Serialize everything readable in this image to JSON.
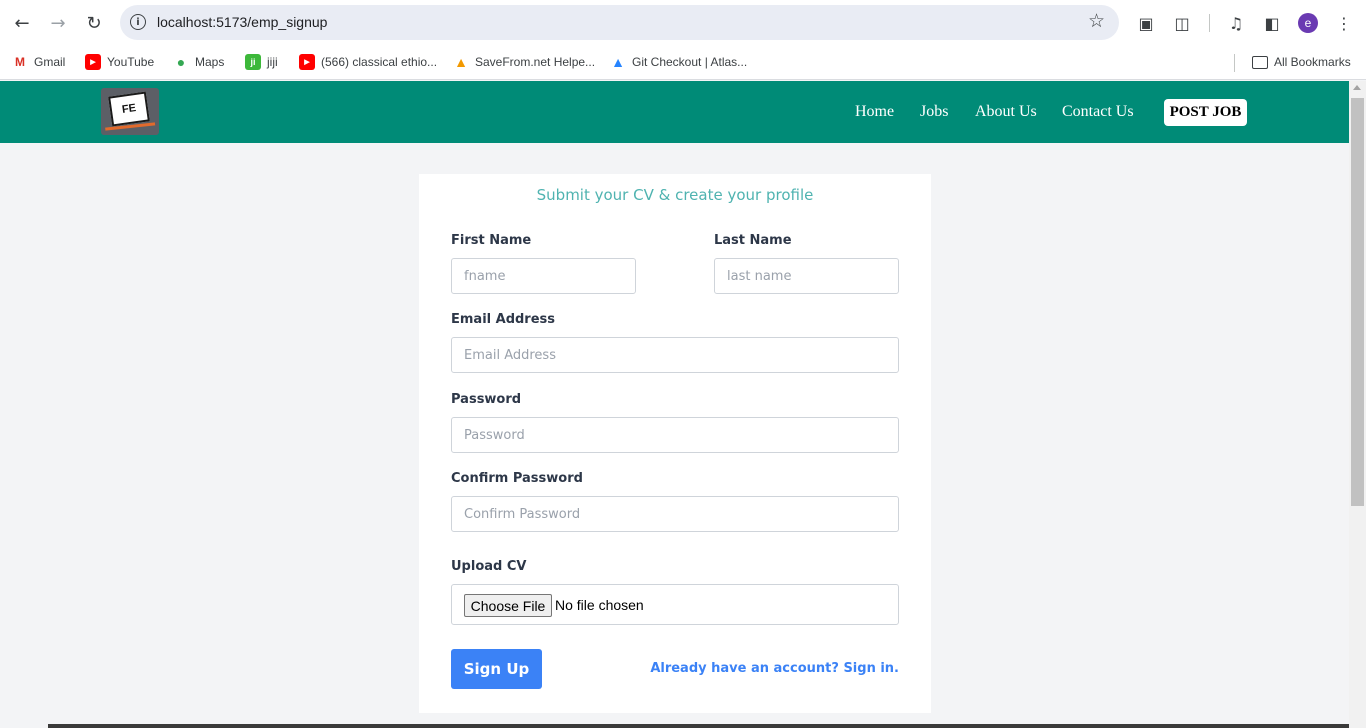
{
  "browser": {
    "url": "localhost:5173/emp_signup",
    "profile_initial": "e"
  },
  "bookmarks": {
    "items": [
      {
        "label": "Gmail",
        "icon": "gmail-icon"
      },
      {
        "label": "YouTube",
        "icon": "youtube-icon"
      },
      {
        "label": "Maps",
        "icon": "maps-icon"
      },
      {
        "label": "jiji",
        "icon": "jiji-icon"
      },
      {
        "label": "(566) classical ethio...",
        "icon": "youtube-icon"
      },
      {
        "label": "SaveFrom.net Helpe...",
        "icon": "savefrom-icon"
      },
      {
        "label": "Git Checkout | Atlas...",
        "icon": "atlassian-icon"
      }
    ],
    "all_bookmarks": "All Bookmarks"
  },
  "navbar": {
    "logo_text": "FE",
    "links": [
      "Home",
      "Jobs",
      "About Us",
      "Contact Us"
    ],
    "post_job": "POST JOB"
  },
  "form": {
    "title": "Submit your CV & create your profile",
    "first_name_label": "First Name",
    "first_name_placeholder": "fname",
    "last_name_label": "Last Name",
    "last_name_placeholder": "last name",
    "email_label": "Email Address",
    "email_placeholder": "Email Address",
    "password_label": "Password",
    "password_placeholder": "Password",
    "confirm_label": "Confirm Password",
    "confirm_placeholder": "Confirm Password",
    "cv_label": "Upload CV",
    "file_button": "Choose File",
    "file_status": "No file chosen",
    "submit": "Sign Up",
    "signin": "Already have an account? Sign in."
  },
  "colors": {
    "navbar": "#008b77",
    "accent_blue": "#3b82f6",
    "title_teal": "#4fb3b0"
  }
}
